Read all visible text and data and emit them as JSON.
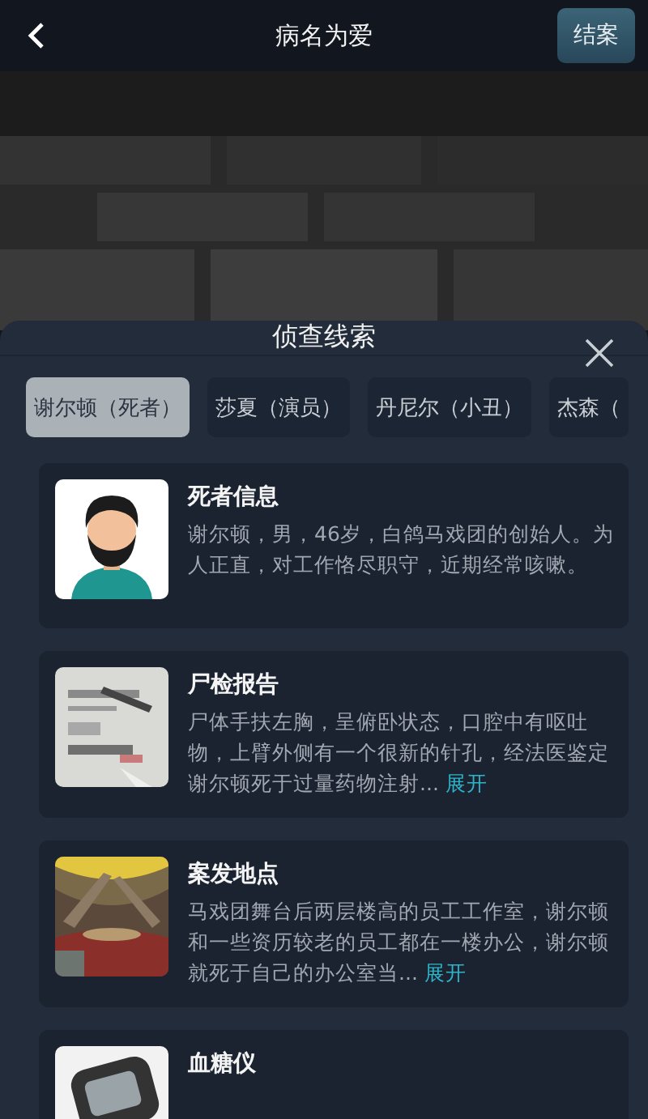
{
  "header": {
    "title": "病名为爱",
    "action": "结案"
  },
  "sheet": {
    "title": "侦查线索",
    "tabs": [
      {
        "label": "谢尔顿（死者）",
        "selected": true
      },
      {
        "label": "莎夏（演员）",
        "selected": false
      },
      {
        "label": "丹尼尔（小丑）",
        "selected": false
      },
      {
        "label": "杰森（",
        "selected": false
      }
    ],
    "clues": [
      {
        "kind": "avatar",
        "title": "死者信息",
        "description": "谢尔顿，男，46岁，白鸽马戏团的创始人。为人正直，对工作恪尽职守，近期经常咳嗽。"
      },
      {
        "kind": "document",
        "title": "尸检报告",
        "description": "尸体手扶左胸，呈俯卧状态，口腔中有呕吐物，上臂外侧有一个很新的针孔，经法医鉴定谢尔顿死于过量药物注射...",
        "expand": "展开"
      },
      {
        "kind": "stage",
        "title": "案发地点",
        "description": "马戏团舞台后两层楼高的员工工作室，谢尔顿和一些资历较老的员工都在一楼办公，谢尔顿就死于自己的办公室当...",
        "expand": "展开"
      },
      {
        "kind": "device",
        "title": "血糖仪"
      }
    ]
  }
}
